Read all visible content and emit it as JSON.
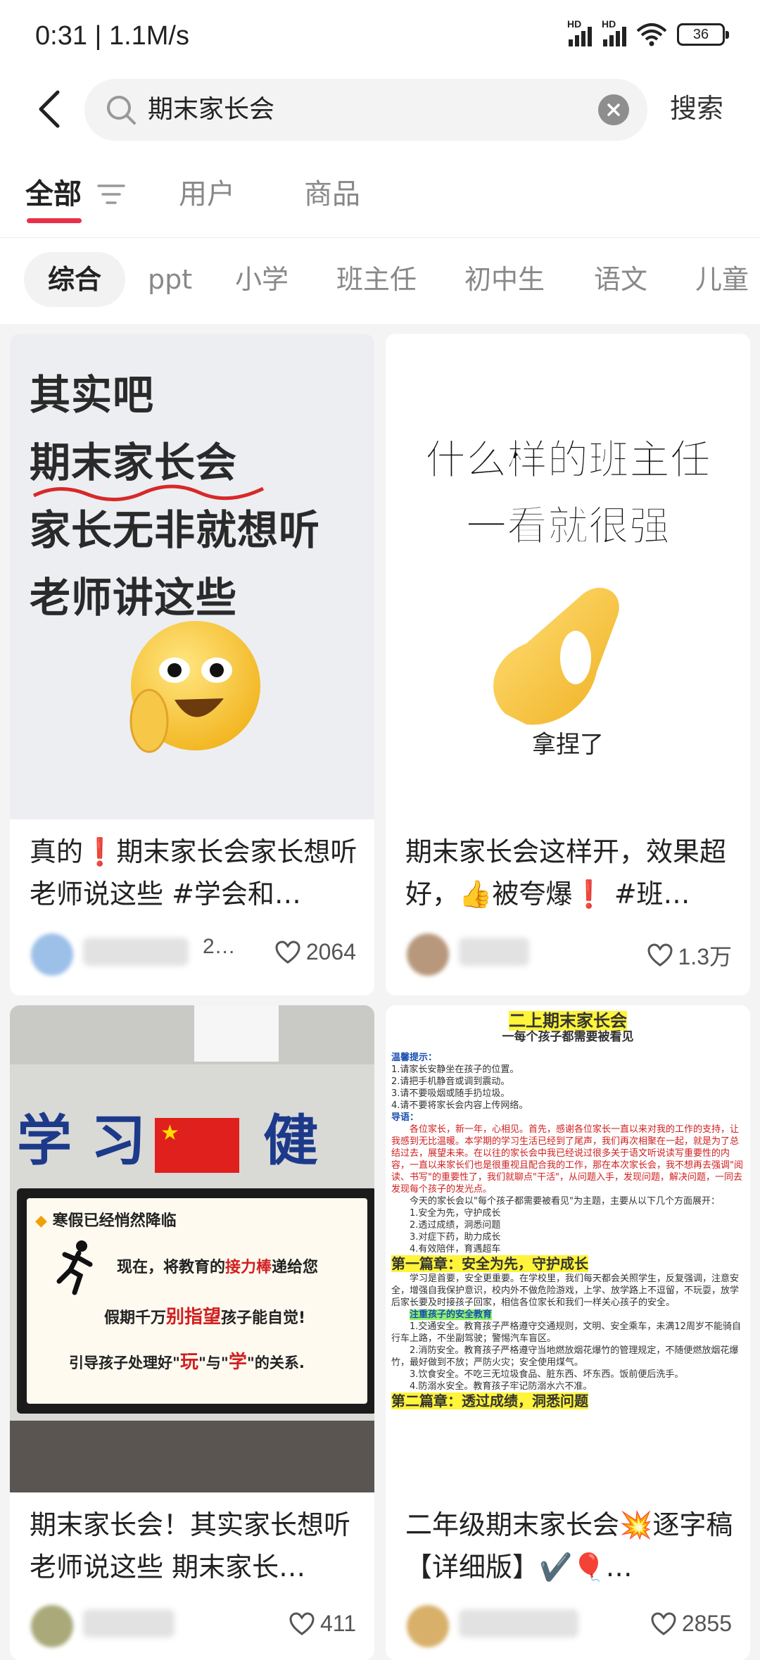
{
  "status_bar": {
    "time": "0:31 | 1.1M/s",
    "signal_1": "HD",
    "signal_2": "HD",
    "battery": "36"
  },
  "header": {
    "query": "期末家长会",
    "search_button": "搜索"
  },
  "tabs": [
    {
      "label": "全部"
    },
    {
      "label": "用户"
    },
    {
      "label": "商品"
    }
  ],
  "chips": [
    "综合",
    "ppt",
    "小学",
    "班主任",
    "初中生",
    "语文",
    "儿童"
  ],
  "feed": [
    {
      "title": "真的❗期末家长会家长想听老师说这些 #学会和…",
      "author_partial": "2…",
      "likes": "2064",
      "cover": {
        "lines": [
          "其实吧",
          "期末家长会",
          "家长无非就想听",
          "老师讲这些"
        ]
      }
    },
    {
      "title": "期末家长会这样开，效果超好，👍被夸爆❗ #班…",
      "likes": "1.3万",
      "cover": {
        "lines": [
          "什么样的班主任",
          "一看就很强"
        ],
        "caption": "拿捏了"
      }
    },
    {
      "title": "期末家长会！其实家长想听老师说这些 期末家长…",
      "likes": "411",
      "cover": {
        "banner_left": "学 习",
        "banner_right": "健 康",
        "board_heading": "寒假已经悄然降临",
        "board_line1_pre": "现在，将教育的",
        "board_line1_hl": "接力棒",
        "board_line1_post": "递给您",
        "board_line2_pre": "假期千万",
        "board_line2_hl": "别指望",
        "board_line2_post": "孩子能自觉!",
        "board_line3_pre": "引导孩子处理好\"",
        "board_line3_hl1": "玩",
        "board_line3_mid": "\"与\"",
        "board_line3_hl2": "学",
        "board_line3_post": "\"的关系."
      }
    },
    {
      "title": "二年级期末家长会💥逐字稿【详细版】✔️🎈…",
      "likes": "2855",
      "cover": {
        "doc_title": "二上期末家长会",
        "doc_subtitle": "一每个孩子都需要被看见",
        "tip_heading": "温馨提示：",
        "tips": [
          "1.请家长安静坐在孩子的位置。",
          "2.请把手机静音或调到震动。",
          "3.请不要吸烟或随手扔垃圾。",
          "4.请不要将家长会内容上传网络。"
        ],
        "guide_heading": "导语：",
        "guide_text": "各位家长，新一年，心相见。首先，感谢各位家长一直以来对我的工作的支持，让我感到无比温暖。本学期的学习生活已经到了尾声，我们再次相聚在一起，就是为了总结过去，展望未来。在以往的家长会中我已经说过很多关于语文听说读写重要性的内容，一直以来家长们也是很重视且配合我的工作，那在本次家长会，我不想再去强调\"阅读、书写\"的重要性了，我们就聊点\"干活\"，从问题入手，发现问题，解决问题，一同去发现每个孩子的发光点。",
        "intro_text": "今天的家长会以\"每个孩子都需要被看见\"为主题，主要从以下几个方面展开：",
        "topics": [
          "1.安全为先，守护成长",
          "2.透过成绩，洞悉问题",
          "3.对症下药，助力成长",
          "4.有效陪伴，育遇超车"
        ],
        "chapter1": "第一篇章：安全为先，守护成长",
        "chapter1_text": "学习是首要，安全更重要。在学校里，我们每天都会关照学生，反复强调，注意安全，增强自我保护意识，校内外不做危险游戏，上学、放学路上不逗留，不玩耍，放学后家长要及时接孩子回家，相信各位家长和我们一样关心孩子的安全。",
        "safety_heading": "注重孩子的安全教育",
        "safety_items": [
          "1.交通安全。教育孩子严格遵守交通规则，文明、安全乘车，未满12周岁不能骑自行车上路，不坐副驾驶；警惕汽车盲区。",
          "2.消防安全。教育孩子严格遵守当地燃放烟花爆竹的管理规定，不随便燃放烟花爆竹，最好做到不放；严防火灾；安全使用煤气。",
          "3.饮食安全。不吃三无垃圾食品、脏东西、坏东西。饭前便后洗手。",
          "4.防溺水安全。教育孩子牢记防溺水六不准。"
        ],
        "chapter2": "第二篇章：透过成绩，洞悉问题"
      }
    }
  ],
  "colors": {
    "accent": "#e8304a",
    "like_icon": "#555555"
  },
  "icons": [
    "back-icon",
    "search-icon",
    "clear-icon",
    "filter-icon",
    "heart-icon",
    "wifi-icon",
    "signal-icon",
    "battery-icon"
  ]
}
